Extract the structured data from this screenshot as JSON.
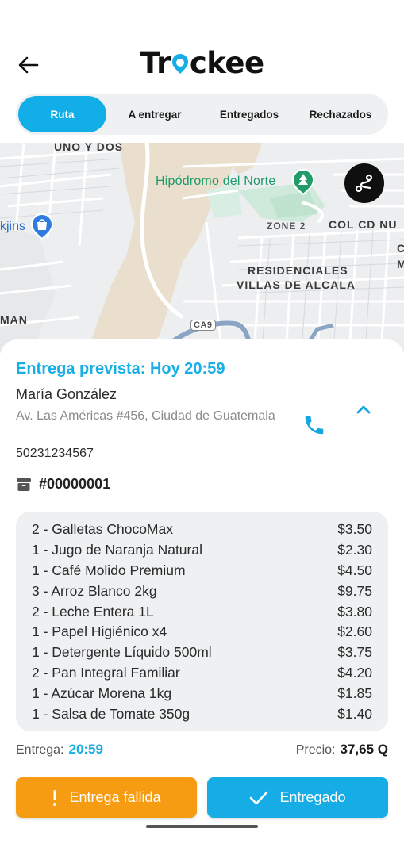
{
  "app": {
    "logo_prefix": "Tr",
    "logo_suffix": "ckee",
    "accent_color": "#16aee6"
  },
  "tabs": [
    {
      "label": "Ruta",
      "active": true
    },
    {
      "label": "A entregar",
      "active": false
    },
    {
      "label": "Entregados",
      "active": false
    },
    {
      "label": "Rechazados",
      "active": false
    }
  ],
  "map": {
    "labels": {
      "uno_y_dos": "UNO Y DOS",
      "hipodromo": "Hipódromo del Norte",
      "zone2": "ZONE 2",
      "col_cd": "COL CD NU",
      "residenciales_1": "RESIDENCIALES",
      "residenciales_2": "VILLAS DE ALCALA",
      "kjins": "kjins",
      "man": "MAN",
      "ca9": "CA9",
      "edge_c": "C",
      "edge_m": "M"
    },
    "route_button_icon": "route-icon"
  },
  "delivery": {
    "eta": "Entrega prevista: Hoy 20:59",
    "customer_name": "María González",
    "address": "Av. Las Américas #456, Ciudad de Guatemala",
    "phone": "50231234567",
    "order_number": "#00000001"
  },
  "items": [
    {
      "name": "2 - Galletas ChocoMax",
      "price": "$3.50"
    },
    {
      "name": "1 - Jugo de Naranja Natural",
      "price": "$2.30"
    },
    {
      "name": "1 - Café Molido Premium",
      "price": "$4.50"
    },
    {
      "name": "3 - Arroz Blanco 2kg",
      "price": "$9.75"
    },
    {
      "name": "2 - Leche Entera 1L",
      "price": "$3.80"
    },
    {
      "name": "1 - Papel Higiénico x4",
      "price": "$2.60"
    },
    {
      "name": "1 - Detergente Líquido 500ml",
      "price": "$3.75"
    },
    {
      "name": "2 - Pan Integral Familiar",
      "price": "$4.20"
    },
    {
      "name": "1 - Azúcar Morena 1kg",
      "price": "$1.85"
    },
    {
      "name": "1 - Salsa de Tomate 350g",
      "price": "$1.40"
    }
  ],
  "summary": {
    "delivery_label": "Entrega:",
    "delivery_time": "20:59",
    "price_label": "Precio:",
    "price_value": "37,65 Q"
  },
  "actions": {
    "fail_label": "Entrega fallida",
    "success_label": "Entregado",
    "fail_color": "#f59c12",
    "success_color": "#16ace6"
  }
}
